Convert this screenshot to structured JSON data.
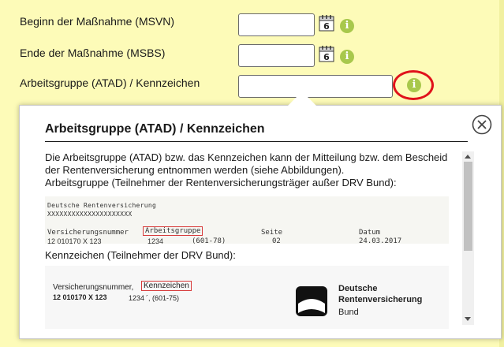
{
  "form": {
    "rows": [
      {
        "label": "Beginn der Maßnahme (MSVN)",
        "value": ""
      },
      {
        "label": "Ende der Maßnahme (MSBS)",
        "value": ""
      },
      {
        "label": "Arbeitsgruppe (ATAD) / Kennzeichen",
        "value": ""
      }
    ],
    "calendar_icon_day": "6",
    "info_icon_glyph": "i"
  },
  "popup": {
    "title": "Arbeitsgruppe (ATAD) / Kennzeichen",
    "paragraph1": "Die Arbeitsgruppe (ATAD) bzw. das Kennzeichen kann der Mitteilung bzw. dem Bescheid der Rentenversicherung entnommen werden (siehe Abbildungen).",
    "paragraph2": "Arbeitsgruppe (Teilnehmer der Rentenversicherungsträger außer DRV Bund):",
    "example1": {
      "header1": "Deutsche Rentenversicherung",
      "header2": "XXXXXXXXXXXXXXXXXXXXX",
      "col_vsnr": "Versicherungsnummer",
      "col_ag": "Arbeitsgruppe",
      "col_seite": "Seite",
      "col_datum": "Datum",
      "val_vsnr": "12 010170 X 123",
      "val_ag": "1234",
      "val_ag_extra": "(601-78)",
      "val_seite": "02",
      "val_datum": "24.03.2017"
    },
    "paragraph3": "Kennzeichen (Teilnehmer der DRV Bund):",
    "example2": {
      "col_vsnr": "Versicherungsnummer,",
      "col_kz": "Kennzeichen",
      "val_vsnr": "12 010170 X 123",
      "val_kz": "1234",
      "val_kz_extra": "´, (601-75)",
      "brand_line1": "Deutsche",
      "brand_line2": "Rentenversicherung",
      "brand_line3": "Bund"
    }
  },
  "colors": {
    "background": "#fdfbb8",
    "info_icon": "#a8c84c",
    "highlight": "#e0121b"
  }
}
